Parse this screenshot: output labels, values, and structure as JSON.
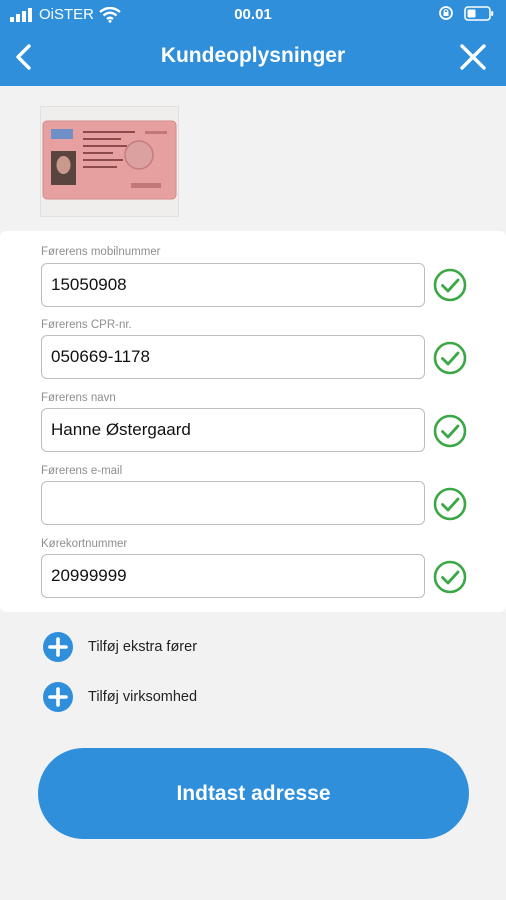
{
  "status": {
    "carrier": "OiSTER",
    "time": "00.01"
  },
  "nav": {
    "title": "Kundeoplysninger"
  },
  "fields": [
    {
      "label": "Førerens mobilnummer",
      "value": "15050908",
      "valid": true
    },
    {
      "label": "Førerens CPR-nr.",
      "value": "050669-1178",
      "valid": true
    },
    {
      "label": "Førerens navn",
      "value": "Hanne Østergaard",
      "valid": true
    },
    {
      "label": "Førerens e-mail",
      "value": "",
      "valid": true
    },
    {
      "label": "Kørekortnummer",
      "value": "20999999",
      "valid": true
    }
  ],
  "actions": {
    "add_driver": "Tilføj ekstra fører",
    "add_company": "Tilføj virksomhed"
  },
  "cta": {
    "label": "Indtast adresse"
  },
  "colors": {
    "brand": "#2f8fdb",
    "check": "#3aa845"
  }
}
